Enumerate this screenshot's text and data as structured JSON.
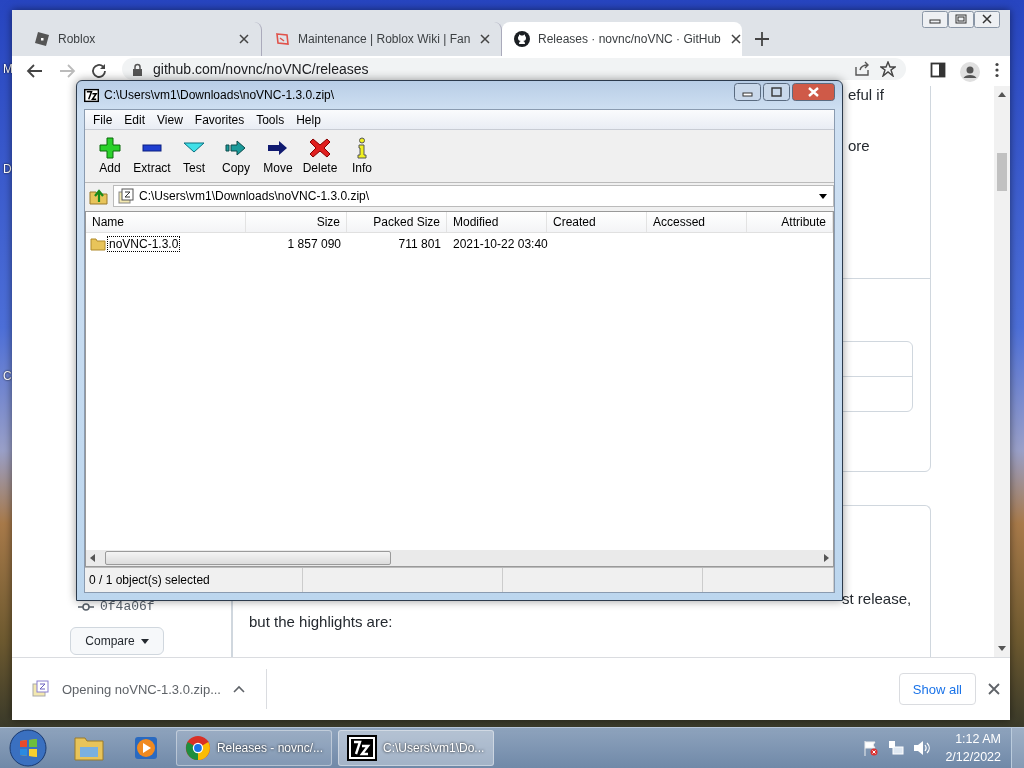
{
  "desktop": {
    "icon_labels": [
      "M",
      "D",
      "C"
    ]
  },
  "browser": {
    "tabs": [
      {
        "title": "Roblox",
        "selected": false
      },
      {
        "title": "Maintenance | Roblox Wiki | Fan",
        "selected": false
      },
      {
        "title": "Releases · novnc/noVNC · GitHub",
        "selected": true
      }
    ],
    "address": "github.com/novnc/noVNC/releases",
    "page": {
      "header_fragments": [
        "eful if",
        "ore"
      ],
      "commit": "0f4a06f",
      "compare_button": "Compare",
      "body_fragment": "st release,",
      "body_text": "but the highlights are:"
    },
    "download_bar": {
      "item": "Opening noVNC-1.3.0.zip...",
      "show_all": "Show all"
    }
  },
  "archiver": {
    "title": "C:\\Users\\vm1\\Downloads\\noVNC-1.3.0.zip\\",
    "menu": [
      "File",
      "Edit",
      "View",
      "Favorites",
      "Tools",
      "Help"
    ],
    "toolbar": [
      {
        "label": "Add",
        "kind": "add"
      },
      {
        "label": "Extract",
        "kind": "extract"
      },
      {
        "label": "Test",
        "kind": "test"
      },
      {
        "label": "Copy",
        "kind": "copy"
      },
      {
        "label": "Move",
        "kind": "move"
      },
      {
        "label": "Delete",
        "kind": "delete"
      },
      {
        "label": "Info",
        "kind": "info"
      }
    ],
    "path": "C:\\Users\\vm1\\Downloads\\noVNC-1.3.0.zip\\",
    "columns": [
      "Name",
      "Size",
      "Packed Size",
      "Modified",
      "Created",
      "Accessed",
      "Attribute"
    ],
    "rows": [
      {
        "name": "noVNC-1.3.0",
        "size": "1 857 090",
        "packed_size": "711 801",
        "modified": "2021-10-22 03:40",
        "focused": true
      }
    ],
    "status": "0 / 1 object(s) selected"
  },
  "taskbar": {
    "buttons": [
      {
        "label": "Releases - novnc/...",
        "selected": false
      },
      {
        "label": "C:\\Users\\vm1\\Do...",
        "selected": true
      }
    ],
    "time": "1:12 AM",
    "date": "2/12/2022"
  }
}
